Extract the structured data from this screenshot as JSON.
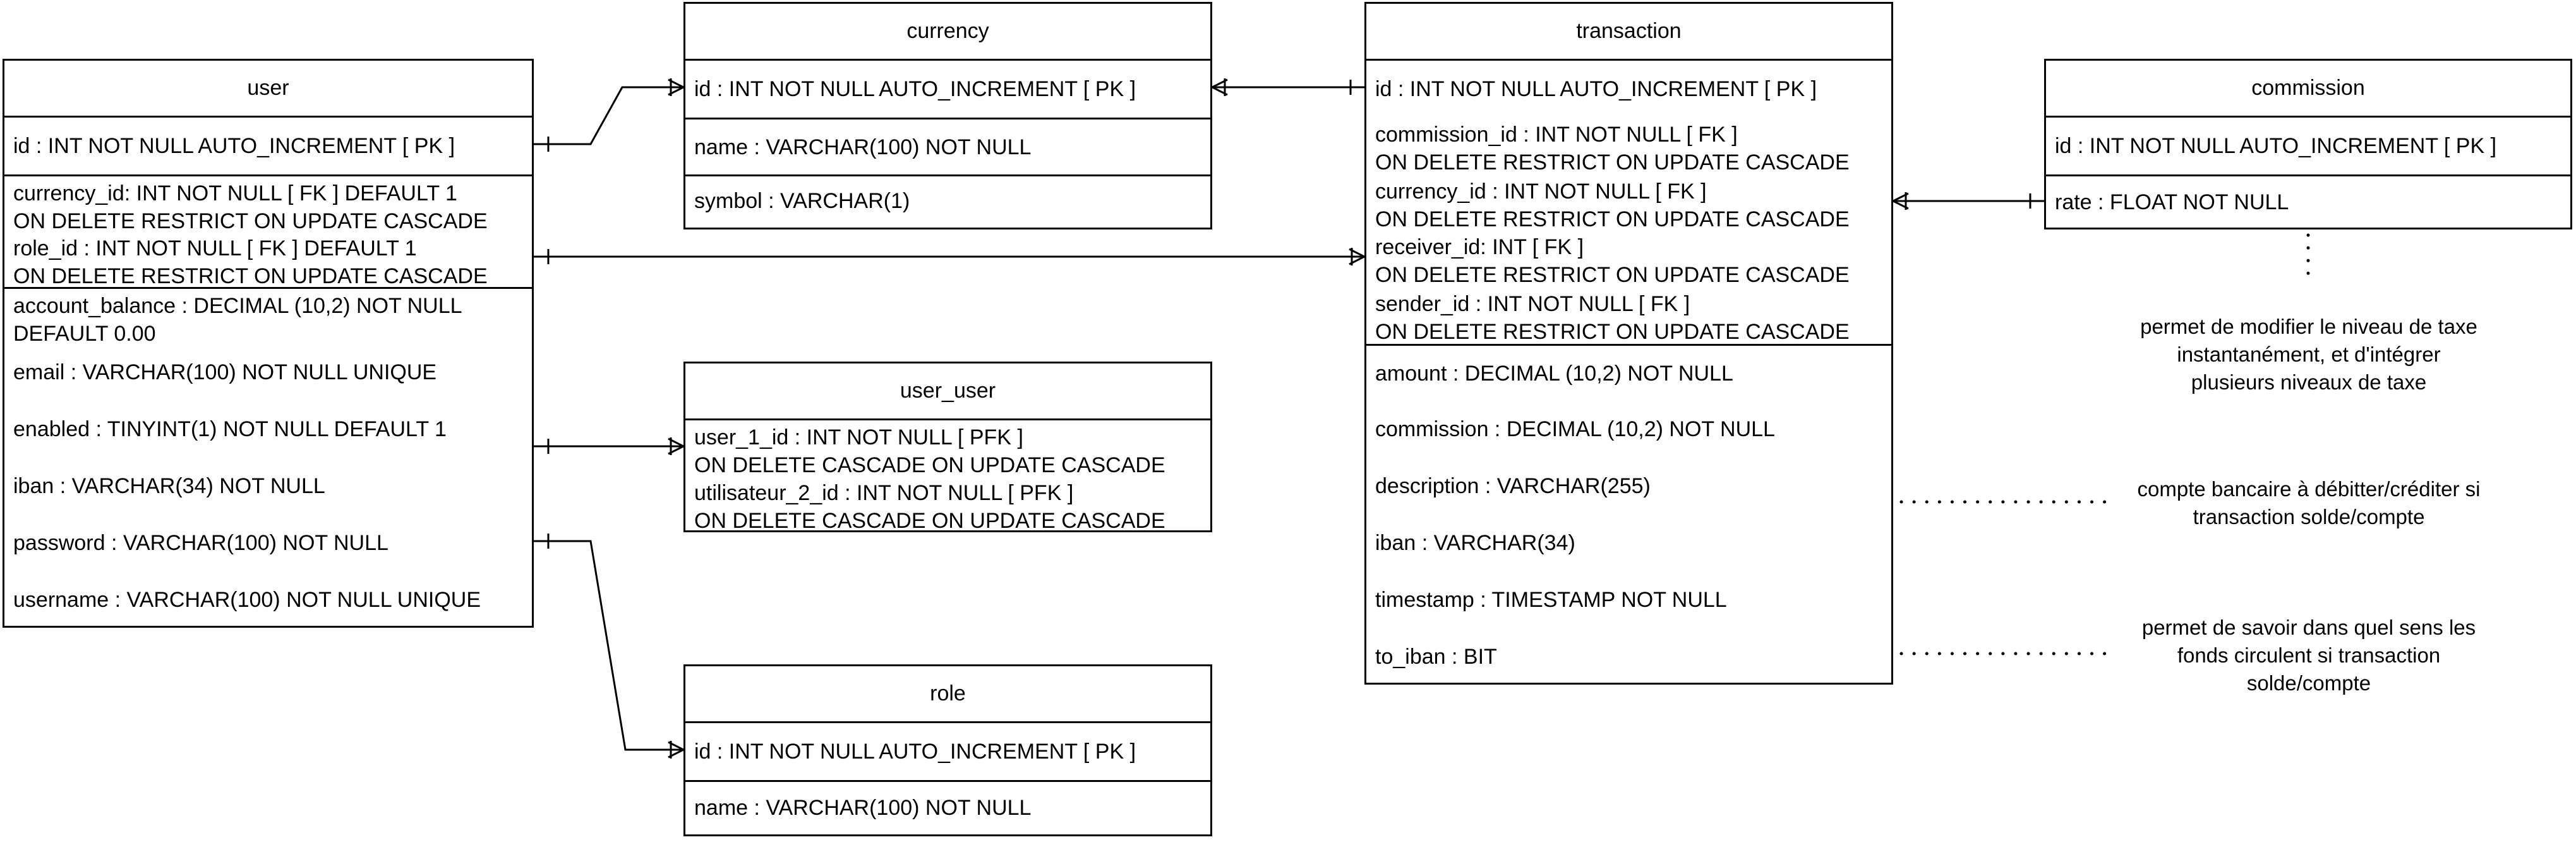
{
  "entities": {
    "user": {
      "title": "user",
      "rows": [
        "id : INT NOT NULL AUTO_INCREMENT [ PK ]",
        [
          "currency_id: INT NOT NULL [ FK ] DEFAULT 1",
          "ON DELETE RESTRICT ON UPDATE CASCADE"
        ],
        [
          "role_id : INT NOT NULL [ FK ] DEFAULT 1",
          "ON DELETE RESTRICT ON UPDATE CASCADE"
        ],
        [
          "account_balance : DECIMAL (10,2) NOT NULL",
          "DEFAULT 0.00"
        ],
        "email : VARCHAR(100) NOT NULL UNIQUE",
        "enabled : TINYINT(1) NOT NULL DEFAULT 1",
        "iban : VARCHAR(34) NOT NULL",
        "password : VARCHAR(100) NOT NULL",
        "username : VARCHAR(100) NOT NULL UNIQUE"
      ]
    },
    "currency": {
      "title": "currency",
      "rows": [
        "id : INT NOT NULL AUTO_INCREMENT [ PK ]",
        "name : VARCHAR(100) NOT NULL",
        "symbol : VARCHAR(1)"
      ]
    },
    "user_user": {
      "title": "user_user",
      "rows": [
        [
          "user_1_id : INT NOT NULL [ PFK ]",
          "ON DELETE CASCADE ON UPDATE CASCADE"
        ],
        [
          "utilisateur_2_id : INT NOT NULL [ PFK ]",
          "ON DELETE CASCADE ON UPDATE CASCADE"
        ]
      ]
    },
    "role": {
      "title": "role",
      "rows": [
        "id : INT NOT NULL AUTO_INCREMENT [ PK ]",
        "name : VARCHAR(100) NOT NULL"
      ]
    },
    "transaction": {
      "title": "transaction",
      "rows": [
        "id : INT NOT NULL AUTO_INCREMENT [ PK ]",
        [
          "commission_id : INT NOT NULL [ FK ]",
          "ON DELETE RESTRICT ON UPDATE CASCADE"
        ],
        [
          "currency_id : INT NOT NULL [ FK ]",
          "ON DELETE RESTRICT ON UPDATE CASCADE"
        ],
        [
          "receiver_id: INT [ FK ]",
          "ON DELETE RESTRICT ON UPDATE CASCADE"
        ],
        [
          "sender_id : INT NOT NULL [ FK ]",
          "ON DELETE RESTRICT ON UPDATE CASCADE"
        ],
        "amount : DECIMAL (10,2) NOT NULL",
        "commission : DECIMAL (10,2) NOT NULL",
        "description : VARCHAR(255)",
        "iban : VARCHAR(34)",
        "timestamp : TIMESTAMP NOT NULL",
        "to_iban : BIT"
      ]
    },
    "commission": {
      "title": "commission",
      "rows": [
        "id : INT NOT NULL AUTO_INCREMENT [ PK ]",
        "rate : FLOAT NOT NULL"
      ]
    }
  },
  "notes": {
    "commission_note": [
      "permet de modifier le niveau de taxe",
      "instantanément, et d'intégrer",
      "plusieurs niveaux de taxe"
    ],
    "iban_note": [
      "compte bancaire à débitter/créditer si",
      "transaction solde/compte"
    ],
    "to_iban_note": [
      "permet de savoir dans quel sens les",
      "fonds circulent si transaction",
      "solde/compte"
    ]
  }
}
